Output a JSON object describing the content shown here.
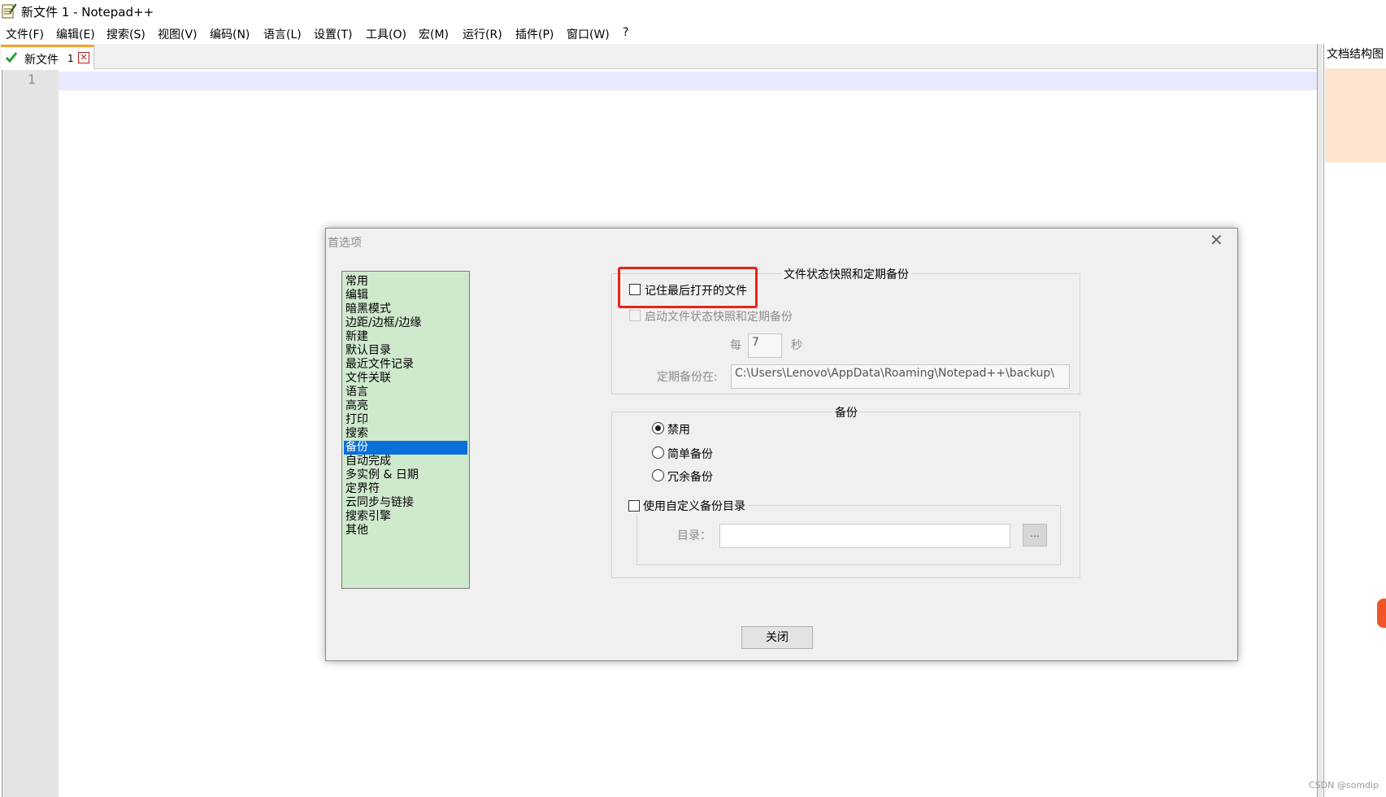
{
  "window": {
    "title": "新文件 1 - Notepad++",
    "icon": "notepad-document-icon"
  },
  "menu": [
    "文件(F)",
    "编辑(E)",
    "搜索(S)",
    "视图(V)",
    "编码(N)",
    "语言(L)",
    "设置(T)",
    "工具(O)",
    "宏(M)",
    "运行(R)",
    "插件(P)",
    "窗口(W)",
    "?"
  ],
  "tabs": [
    {
      "label": "新文件",
      "index": "1",
      "saved_icon": "green-check-icon",
      "close_icon": "red-close-icon"
    }
  ],
  "editor": {
    "line_numbers": [
      "1"
    ]
  },
  "side_panel": {
    "title": "文档结构图"
  },
  "watermark": "CSDN @somdip",
  "dialog": {
    "title": "首选项",
    "close_icon": "close-x-icon",
    "categories": [
      "常用",
      "编辑",
      "暗黑模式",
      "边距/边框/边缘",
      "新建",
      "默认目录",
      "最近文件记录",
      "文件关联",
      "语言",
      "高亮",
      "打印",
      "搜索",
      "备份",
      "自动完成",
      "多实例 & 日期",
      "定界符",
      "云同步与链接",
      "搜索引擎",
      "其他"
    ],
    "selected_category": "备份",
    "snapshot_group": {
      "legend": "文件状态快照和定期备份",
      "remember_last_session": {
        "label": "记住最后打开的文件",
        "checked": false
      },
      "enable_snapshot": {
        "label": "启动文件状态快照和定期备份",
        "checked": false,
        "enabled": false
      },
      "every_label": "每",
      "interval_value": "7",
      "seconds_label": "秒",
      "backup_path_label": "定期备份在:",
      "backup_path_value": "C:\\Users\\Lenovo\\AppData\\Roaming\\Notepad++\\backup\\"
    },
    "backup_group": {
      "legend": "备份",
      "options": [
        {
          "label": "禁用",
          "checked": true
        },
        {
          "label": "简单备份",
          "checked": false
        },
        {
          "label": "冗余备份",
          "checked": false
        }
      ],
      "custom_dir": {
        "label": "使用自定义备份目录",
        "checked": false
      },
      "dir_label": "目录：",
      "dir_value": "",
      "browse_label": "..."
    },
    "close_button": "关闭"
  },
  "colors": {
    "highlight": "#e8231a",
    "list_bg": "#cfe9cd",
    "selection": "#0a6fd8",
    "tab_accent": "#f5a623"
  }
}
